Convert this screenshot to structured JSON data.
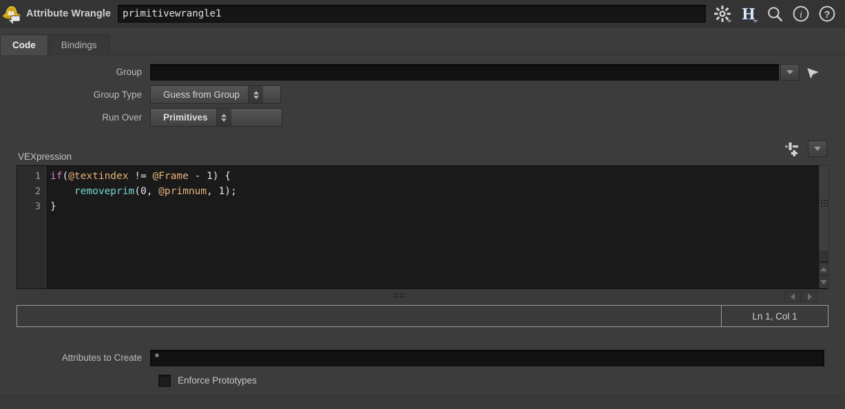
{
  "header": {
    "icon": "attribute-wrangle-node-icon",
    "title": "Attribute Wrangle",
    "node_name": "primitivewrangle1",
    "icons": [
      {
        "name": "gear-icon",
        "label": "Gear"
      },
      {
        "name": "houdini-h-icon",
        "label": "H"
      },
      {
        "name": "search-icon",
        "label": "Search"
      },
      {
        "name": "info-icon",
        "label": "Info"
      },
      {
        "name": "help-icon",
        "label": "Help"
      }
    ]
  },
  "tabs": [
    {
      "label": "Code",
      "active": true
    },
    {
      "label": "Bindings",
      "active": false
    }
  ],
  "params": {
    "group": {
      "label": "Group",
      "value": "",
      "menu_icon": "chevron-down-icon",
      "pick_icon": "pick-arrow-icon"
    },
    "group_type": {
      "label": "Group Type",
      "value": "Guess from Group"
    },
    "run_over": {
      "label": "Run Over",
      "value": "Primitives"
    }
  },
  "vexpression": {
    "label": "VEXpression",
    "insert_icon": "insert-snippet-icon",
    "menu_icon": "chevron-down-icon",
    "line_numbers": [
      "1",
      "2",
      "3"
    ],
    "code_lines": [
      [
        {
          "t": "if",
          "c": "kw"
        },
        {
          "t": "(",
          "c": "pl"
        },
        {
          "t": "@textindex",
          "c": "attr"
        },
        {
          "t": " != ",
          "c": "pl"
        },
        {
          "t": "@Frame",
          "c": "attr"
        },
        {
          "t": " - ",
          "c": "pl"
        },
        {
          "t": "1",
          "c": "num"
        },
        {
          "t": ") {",
          "c": "pl"
        }
      ],
      [
        {
          "t": "    ",
          "c": "pl"
        },
        {
          "t": "removeprim",
          "c": "fn"
        },
        {
          "t": "(",
          "c": "pl"
        },
        {
          "t": "0",
          "c": "num"
        },
        {
          "t": ", ",
          "c": "pl"
        },
        {
          "t": "@primnum",
          "c": "attr"
        },
        {
          "t": ", ",
          "c": "pl"
        },
        {
          "t": "1",
          "c": "num"
        },
        {
          "t": ");",
          "c": "pl"
        }
      ],
      [
        {
          "t": "}",
          "c": "pl"
        }
      ]
    ],
    "status_input_value": "",
    "cursor_position": "Ln 1, Col 1"
  },
  "bottom": {
    "attributes_to_create": {
      "label": "Attributes to Create",
      "value": "*"
    },
    "enforce_prototypes": {
      "label": "Enforce Prototypes",
      "checked": false
    }
  },
  "colors": {
    "panel_bg": "#3c3c3c",
    "header_bg": "#343434",
    "field_bg": "#121212",
    "code_bg": "#1a1a1a",
    "gutter_bg": "#2c2c2c",
    "keyword": "#e07cd6",
    "attribute": "#e6b47a",
    "function": "#74d4cf",
    "text": "#e6e6e6",
    "logo_gold": "#d6a818"
  }
}
